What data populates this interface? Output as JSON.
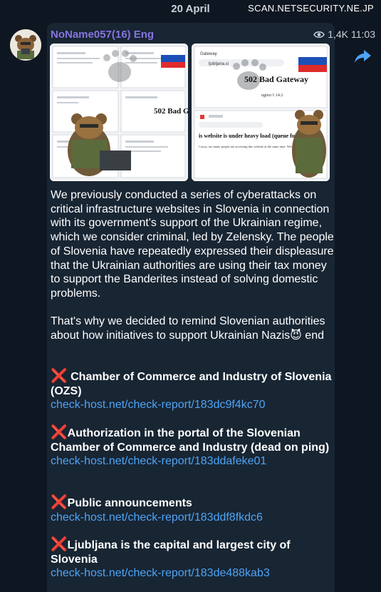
{
  "header": {
    "date": "20 April",
    "watermark": "SCAN.NETSECURITY.NE.JP"
  },
  "message": {
    "sender": "NoName057(16) Eng",
    "views": "1,4K",
    "time": "11:03",
    "photos": [
      {
        "page_title": "502 Bad Gate"
      },
      {
        "tab_label": "Gateway",
        "url": "ljubljana.si",
        "headline": "502 Bad Gateway",
        "server": "nginx/1.14.2",
        "subline": "is website is under heavy load (queue full)",
        "detail": "l sorry, too many people are accessing this website at the same time. We're wor"
      }
    ],
    "paragraph1": "We previously conducted a series of cyberattacks on critical infrastructure websites in Slovenia in connection with its government's support of the Ukrainian regime, which we consider criminal, led by Zelensky. The people of Slovenia have repeatedly expressed their displeasure that the Ukrainian authorities are using their tax money to support the Banderites instead of solving domestic problems.",
    "paragraph2_before": "That's why we decided to remind Slovenian authorities about how initiatives to support Ukrainian Nazis",
    "paragraph2_emoji": "😈",
    "paragraph2_after": " end",
    "x_mark": "❌",
    "items": [
      {
        "title": " Chamber of Commerce and Industry of Slovenia (OZS)",
        "link": "check-host.net/check-report/183dc9f4kc70"
      },
      {
        "title": "Authorization in the portal of the Slovenian Chamber of Commerce and Industry (dead on ping)",
        "link": "check-host.net/check-report/183ddafeke01"
      },
      {
        "title": "Public announcements",
        "link": "check-host.net/check-report/183ddf8fkdc6"
      },
      {
        "title": "Ljubljana is the capital and largest city of Slovenia",
        "link": "check-host.net/check-report/183de488kab3"
      }
    ]
  },
  "colors": {
    "background": "#0e1621",
    "bubble": "#182533",
    "sender": "#8774e1",
    "link": "#4ea4f6",
    "x_mark": "#e53935"
  },
  "icons": {
    "views": "eye-icon",
    "share": "share-arrow-icon"
  }
}
